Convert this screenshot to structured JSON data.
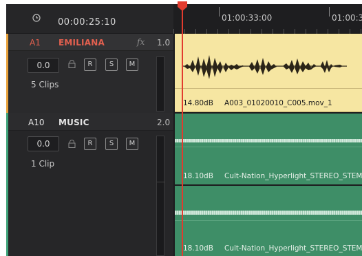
{
  "header": {
    "timecode": "00:00:25:10",
    "ruler_labels": [
      "01:00:33:00",
      "01:00:3"
    ]
  },
  "tracks": [
    {
      "id": "A1",
      "name": "EMILIANA",
      "fx": "fx",
      "number": "1.0",
      "volume": "0.0",
      "buttons": [
        "R",
        "S",
        "M"
      ],
      "clip_count": "5 Clips",
      "clips": [
        {
          "level": "14.80dB",
          "name": "A003_01020010_C005.mov_1"
        }
      ]
    },
    {
      "id": "A10",
      "name": "MUSIC",
      "number": "2.0",
      "volume": "0.0",
      "buttons": [
        "R",
        "S",
        "M"
      ],
      "clip_count": "1 Clip",
      "clips": [
        {
          "level": "18.10dB",
          "name": "Cult-Nation_Hyperlight_STEREO_STEM"
        },
        {
          "level": "18.10dB",
          "name": "Cult-Nation_Hyperlight_STEREO_STEM"
        }
      ]
    }
  ],
  "colors": {
    "a1_accent": "#e9a23b",
    "a1_label": "#e3604f",
    "music_accent": "#3fa37a",
    "playhead": "#e23b2e",
    "audio_clip": "#f6e6a2",
    "music_clip": "#3e8e67"
  },
  "icons": [
    "clock-icon",
    "lock-icon",
    "playhead-handle-icon"
  ]
}
